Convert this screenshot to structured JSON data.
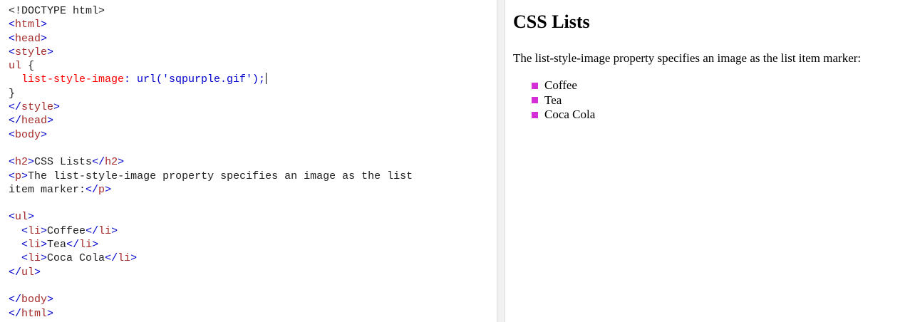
{
  "editor": {
    "lines": [
      [
        {
          "t": "<!DOCTYPE html>",
          "c": "plain"
        }
      ],
      [
        {
          "t": "<",
          "c": "br"
        },
        {
          "t": "html",
          "c": "tag"
        },
        {
          "t": ">",
          "c": "br"
        }
      ],
      [
        {
          "t": "<",
          "c": "br"
        },
        {
          "t": "head",
          "c": "tag"
        },
        {
          "t": ">",
          "c": "br"
        }
      ],
      [
        {
          "t": "<",
          "c": "br"
        },
        {
          "t": "style",
          "c": "tag"
        },
        {
          "t": ">",
          "c": "br"
        }
      ],
      [
        {
          "t": "ul",
          "c": "sel"
        },
        {
          "t": " {",
          "c": "plain"
        }
      ],
      [
        {
          "t": "  list-style-image",
          "c": "prop"
        },
        {
          "t": ": url('sqpurple.gif');",
          "c": "val"
        },
        {
          "t": "",
          "c": "caret"
        }
      ],
      [
        {
          "t": "}",
          "c": "plain"
        }
      ],
      [
        {
          "t": "</",
          "c": "br"
        },
        {
          "t": "style",
          "c": "tag"
        },
        {
          "t": ">",
          "c": "br"
        }
      ],
      [
        {
          "t": "</",
          "c": "br"
        },
        {
          "t": "head",
          "c": "tag"
        },
        {
          "t": ">",
          "c": "br"
        }
      ],
      [
        {
          "t": "<",
          "c": "br"
        },
        {
          "t": "body",
          "c": "tag"
        },
        {
          "t": ">",
          "c": "br"
        }
      ],
      [],
      [
        {
          "t": "<",
          "c": "br"
        },
        {
          "t": "h2",
          "c": "tag"
        },
        {
          "t": ">",
          "c": "br"
        },
        {
          "t": "CSS Lists",
          "c": "plain"
        },
        {
          "t": "</",
          "c": "br"
        },
        {
          "t": "h2",
          "c": "tag"
        },
        {
          "t": ">",
          "c": "br"
        }
      ],
      [
        {
          "t": "<",
          "c": "br"
        },
        {
          "t": "p",
          "c": "tag"
        },
        {
          "t": ">",
          "c": "br"
        },
        {
          "t": "The list-style-image property specifies an image as the list",
          "c": "plain"
        }
      ],
      [
        {
          "t": "item marker:",
          "c": "plain"
        },
        {
          "t": "</",
          "c": "br"
        },
        {
          "t": "p",
          "c": "tag"
        },
        {
          "t": ">",
          "c": "br"
        }
      ],
      [],
      [
        {
          "t": "<",
          "c": "br"
        },
        {
          "t": "ul",
          "c": "tag"
        },
        {
          "t": ">",
          "c": "br"
        }
      ],
      [
        {
          "t": "  <",
          "c": "br"
        },
        {
          "t": "li",
          "c": "tag"
        },
        {
          "t": ">",
          "c": "br"
        },
        {
          "t": "Coffee",
          "c": "plain"
        },
        {
          "t": "</",
          "c": "br"
        },
        {
          "t": "li",
          "c": "tag"
        },
        {
          "t": ">",
          "c": "br"
        }
      ],
      [
        {
          "t": "  <",
          "c": "br"
        },
        {
          "t": "li",
          "c": "tag"
        },
        {
          "t": ">",
          "c": "br"
        },
        {
          "t": "Tea",
          "c": "plain"
        },
        {
          "t": "</",
          "c": "br"
        },
        {
          "t": "li",
          "c": "tag"
        },
        {
          "t": ">",
          "c": "br"
        }
      ],
      [
        {
          "t": "  <",
          "c": "br"
        },
        {
          "t": "li",
          "c": "tag"
        },
        {
          "t": ">",
          "c": "br"
        },
        {
          "t": "Coca Cola",
          "c": "plain"
        },
        {
          "t": "</",
          "c": "br"
        },
        {
          "t": "li",
          "c": "tag"
        },
        {
          "t": ">",
          "c": "br"
        }
      ],
      [
        {
          "t": "</",
          "c": "br"
        },
        {
          "t": "ul",
          "c": "tag"
        },
        {
          "t": ">",
          "c": "br"
        }
      ],
      [],
      [
        {
          "t": "</",
          "c": "br"
        },
        {
          "t": "body",
          "c": "tag"
        },
        {
          "t": ">",
          "c": "br"
        }
      ],
      [
        {
          "t": "</",
          "c": "br"
        },
        {
          "t": "html",
          "c": "tag"
        },
        {
          "t": ">",
          "c": "br"
        }
      ]
    ]
  },
  "result": {
    "heading": "CSS Lists",
    "paragraph": "The list-style-image property specifies an image as the list item marker:",
    "items": [
      "Coffee",
      "Tea",
      "Coca Cola"
    ],
    "marker_color": "#d42fd6"
  }
}
